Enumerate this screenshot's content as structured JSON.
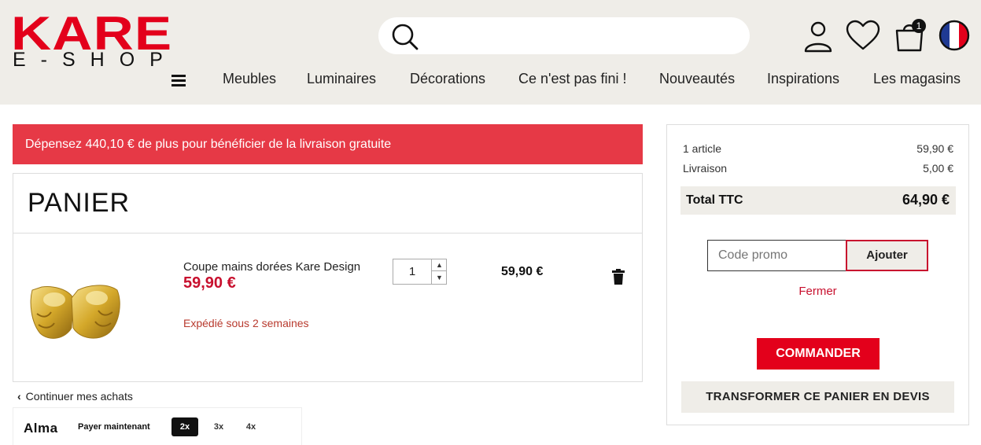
{
  "header": {
    "logo_main": "KARE",
    "logo_sub": "E-SHOP",
    "search": {
      "placeholder": ""
    },
    "cart_count": "1",
    "nav": [
      "Meubles",
      "Luminaires",
      "Décorations",
      "Ce n'est pas fini !",
      "Nouveautés",
      "Inspirations",
      "Les magasins"
    ],
    "icons": [
      "search-icon",
      "user-icon",
      "heart-icon",
      "cart-icon",
      "flag-fr-icon",
      "menu-icon"
    ]
  },
  "banner": {
    "text": "Dépensez 440,10 € de plus pour bénéficier de la livraison gratuite"
  },
  "cart": {
    "title": "PANIER",
    "item": {
      "name": "Coupe mains dorées Kare Design",
      "price": "59,90 €",
      "shipping": "Expédié sous 2 semaines",
      "quantity": "1",
      "line_total": "59,90 €"
    },
    "continue_label": "Continuer mes achats"
  },
  "alma": {
    "logo": "Alma",
    "pay_now": "Payer maintenant",
    "options": [
      "2x",
      "3x",
      "4x"
    ],
    "selected": "2x"
  },
  "summary": {
    "articles_label": "1 article",
    "articles_value": "59,90 €",
    "shipping_label": "Livraison",
    "shipping_value": "5,00 €",
    "total_label": "Total TTC",
    "total_value": "64,90 €",
    "promo_placeholder": "Code promo",
    "promo_button": "Ajouter",
    "close_link": "Fermer",
    "order_button": "COMMANDER",
    "quote_button": "TRANSFORMER CE PANIER EN DEVIS"
  },
  "colors": {
    "brand_red": "#e3001b",
    "banner_red": "#e63946",
    "header_bg": "#efede8"
  }
}
